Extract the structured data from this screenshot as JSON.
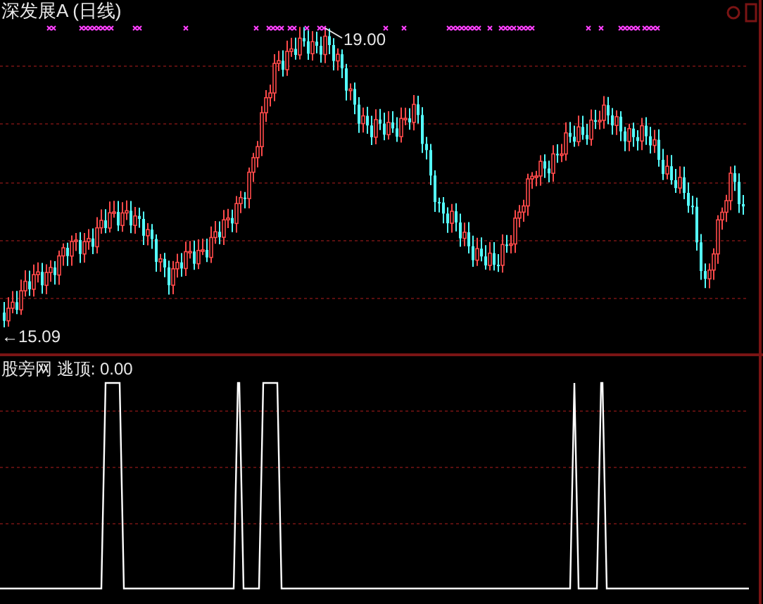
{
  "price_chart": {
    "title": "深发展A (日线)",
    "high_label": "19.00",
    "low_label": "←15.09"
  },
  "indicator_chart": {
    "title": "股旁网 逃顶: 0.00"
  }
}
